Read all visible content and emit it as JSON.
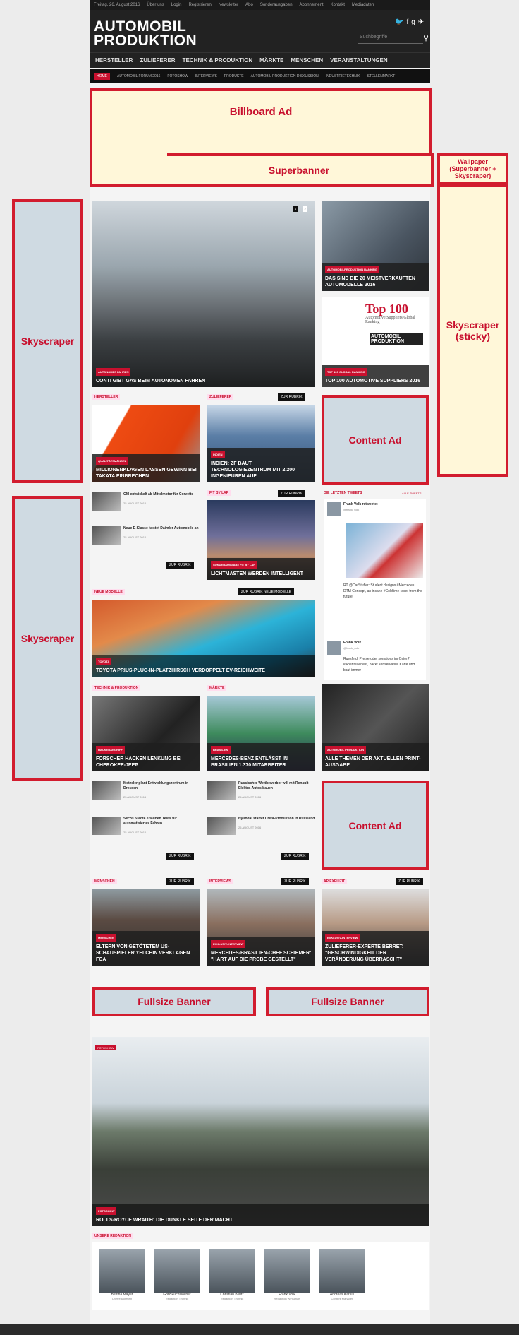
{
  "topbar": {
    "date": "Freitag, 26. August 2016",
    "links": [
      "Über uns",
      "Login",
      "Registrieren",
      "Newsletter",
      "Abo",
      "Sonderausgaben",
      "Abonnement",
      "Kontakt",
      "Mediadaten"
    ]
  },
  "logo": {
    "line1": "AUTOMOBIL",
    "line2": "PRODUKTION"
  },
  "social_icons": "twitter facebook google-plus share",
  "search": {
    "placeholder": "Suchbegriffe"
  },
  "mainnav": [
    "HERSTELLER",
    "ZULIEFERER",
    "TECHNIK & PRODUKTION",
    "MÄRKTE",
    "MENSCHEN",
    "VERANSTALTUNGEN"
  ],
  "subnav": [
    "HOME",
    "AUTOMOBIL FORUM 2016",
    "FOTOSHOW",
    "INTERVIEWS",
    "PRODUKTE",
    "AUTOMOBIL PRODUKTION DISKUSSION",
    "INDUSTRIETECHNIK",
    "STELLENMARKT"
  ],
  "ads": {
    "billboard": "Billboard Ad",
    "superbanner": "Superbanner",
    "wallpaper": "Wallpaper (Superbanner + Skyscraper)",
    "skyscraper_sticky": "Skyscraper (sticky)",
    "skyscraper1": "Skyscraper",
    "skyscraper2": "Skyscraper",
    "content1": "Content Ad",
    "content2": "Content Ad",
    "fullsize1": "Fullsize Banner",
    "fullsize2": "Fullsize Banner"
  },
  "hero": {
    "tag": "AUTONOMES FAHREN",
    "title": "CONTI GIBT GAS BEIM AUTONOMEN FAHREN"
  },
  "side1": {
    "tag": "AUTOMOBILPRODUKTION RANKING",
    "title": "DAS SIND DIE 20 MEISTVERKAUFTEN AUTOMODELLE 2016"
  },
  "side2": {
    "tag": "TOP 100 GLOBAL RANKING",
    "title": "TOP 100 AUTOMOTIVE SUPPLIERS 2016",
    "badge_top": "Top 100",
    "badge_sub": "Automotive Suppliers Global Ranking",
    "badge_brand": "AUTOMOBIL PRODUKTION"
  },
  "sections": {
    "hersteller": "HERSTELLER",
    "zulieferer": "ZULIEFERER",
    "fitbitlap": "FIT BY LAP",
    "neue": "NEUE MODELLE",
    "technik": "TECHNIK & PRODUKTION",
    "maerkte": "MÄRKTE",
    "menschen": "MENSCHEN",
    "interviews": "INTERVIEWS",
    "apexplizit": "AP EXPLIZIT",
    "redaktion": "UNSERE REDAKTION",
    "tweets": "DIE LETZTEN TWEETS",
    "alle_tweets": "ALLE TWEETS"
  },
  "more_label": "ZUR RUBRIK",
  "more_neue": "ZUR RUBRIK NEUE MODELLE",
  "tiles": {
    "t1": {
      "tag": "QUALITÄTSMÄNGEL",
      "title": "MILLIONENKLAGEN LASSEN GEWINN BEI TAKATA EINBRECHEN"
    },
    "t2": {
      "tag": "INDIEN",
      "title": "INDIEN: ZF BAUT TECHNOLOGIEZENTRUM MIT 2.200 INGENIEUREN AUF"
    },
    "t3": {
      "tag": "SONDERAUSGABE FIT BY LAP",
      "title": "LICHTMASTEN WERDEN INTELLIGENT"
    },
    "t4": {
      "tag": "TOYOTA",
      "title": "TOYOTA PRIUS-PLUG-IN-PLATZHIRSCH VERDOPPELT EV-REICHWEITE"
    },
    "t5": {
      "tag": "HACKERANGRIFF",
      "title": "FORSCHER HACKEN LENKUNG BEI CHEROKEE-JEEP"
    },
    "t6": {
      "tag": "BRASILIEN",
      "title": "MERCEDES-BENZ ENTLÄSST IN BRASILIEN 1.370 MITARBEITER"
    },
    "t7": {
      "tag": "AUTOMOBIL PRODUKTION",
      "title": "ALLE THEMEN DER AKTUELLEN PRINT-AUSGABE"
    },
    "t8": {
      "tag": "MENSCHEN",
      "title": "ELTERN VON GETÖTETEM US-SCHAUSPIELER YELCHIN VERKLAGEN FCA"
    },
    "t9": {
      "tag": "EXKLUSIV-INTERVIEW",
      "title": "MERCEDES-BRASILIEN-CHEF SCHIEMER: \"HART AUF DIE PROBE GESTELLT\""
    },
    "t10": {
      "tag": "EXKLUSIV-INTERVIEW",
      "title": "ZULIEFERER-EXPERTE BERRET: \"GESCHWINDIGKEIT DER VERÄNDERUNG ÜBERRASCHT\""
    },
    "big": {
      "tag": "FOTOSHOW",
      "title": "ROLLS-ROYCE WRAITH: DIE DUNKLE SEITE DER MACHT"
    }
  },
  "list1": [
    {
      "title": "GM entwickelt ab Mittelmotor für Corvette",
      "date": "25.AUGUST 2016"
    },
    {
      "title": "Neue E-Klasse kostet Daimler Automobile an",
      "date": "25.AUGUST 2016"
    }
  ],
  "list2": [
    {
      "title": "Metzeler plant Entwicklungszentrum in Dresden",
      "date": "25.AUGUST 2016"
    },
    {
      "title": "Sechs Städte erlauben Tests für automatisiertes Fahren",
      "date": "25.AUGUST 2016"
    }
  ],
  "list3": [
    {
      "title": "Russischer Wettbewerber will mit Renault Elektro-Autos bauen",
      "date": "25.AUGUST 2016"
    },
    {
      "title": "Hyundai startet Creta-Produktion in Russland",
      "date": "25.AUGUST 2016"
    }
  ],
  "tweets": {
    "t1_user": "Frank Volk retweetet",
    "t1_handle": "@frank_volk",
    "t1_text": "RT @CarStuffer: Student designs #Mercedes DTM Concept, an insane #Coldtime racer from the future",
    "t2_user": "Frank Volk",
    "t2_handle": "@frank_volk",
    "t2_text": "Ruesfeld: Preise oder sonstiges im Oster? #Abenteuerfest, packt konservative Karte und baut immer"
  },
  "team": [
    {
      "name": "Bettina Mayer",
      "role": "Chefredakteurin"
    },
    {
      "name": "Götz Fuchslocher",
      "role": "Redaktion Technik"
    },
    {
      "name": "Christian Blaitz",
      "role": "Redaktion Technik"
    },
    {
      "name": "Frank Volk",
      "role": "Redaktion Wirtschaft"
    },
    {
      "name": "Andreas Karius",
      "role": "Content Manager"
    }
  ]
}
